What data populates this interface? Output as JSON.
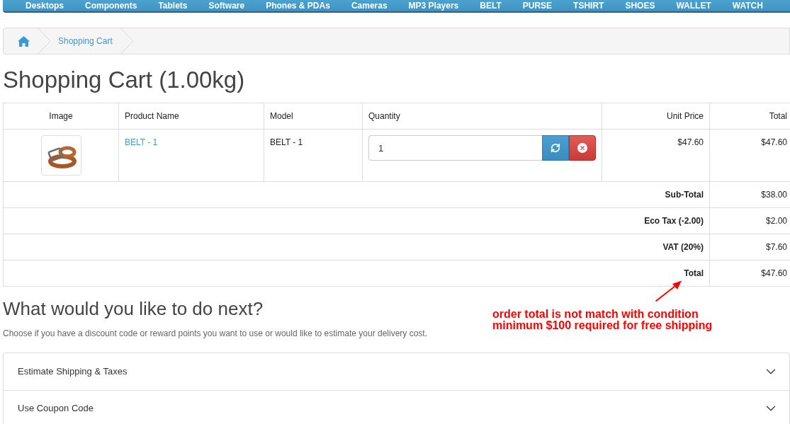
{
  "nav_menu": [
    "Desktops",
    "Components",
    "Tablets",
    "Software",
    "Phones & PDAs",
    "Cameras",
    "MP3 Players",
    "BELT",
    "PURSE",
    "TSHIRT",
    "SHOES",
    "WALLET",
    "WATCH"
  ],
  "breadcrumb": [
    "Shopping Cart"
  ],
  "heading": "Shopping Cart (1.00kg)",
  "cart_table": {
    "columns": [
      "Image",
      "Product Name",
      "Model",
      "Quantity",
      "Unit Price",
      "Total"
    ],
    "rows": [
      {
        "product_name": "BELT - 1",
        "model": "BELT - 1",
        "quantity": "1",
        "unit_price": "$47.60",
        "total": "$47.60"
      }
    ],
    "totals": [
      {
        "label": "Sub-Total",
        "value": "$38.00"
      },
      {
        "label": "Eco Tax (-2.00)",
        "value": "$2.00"
      },
      {
        "label": "VAT (20%)",
        "value": "$7.60"
      },
      {
        "label": "Total",
        "value": "$47.60"
      }
    ]
  },
  "annotation": {
    "lines": [
      "order total is not match with condition",
      "minimum $100 required for free shipping"
    ]
  },
  "next_steps": {
    "title": "What would you like to do next?",
    "description": "Choose if you have a discount code or reward points you want to use or would like to estimate your delivery cost.",
    "panels": [
      {
        "title": "Estimate Shipping & Taxes",
        "expanded": false
      },
      {
        "title": "Use Coupon Code",
        "expanded": false
      }
    ]
  }
}
